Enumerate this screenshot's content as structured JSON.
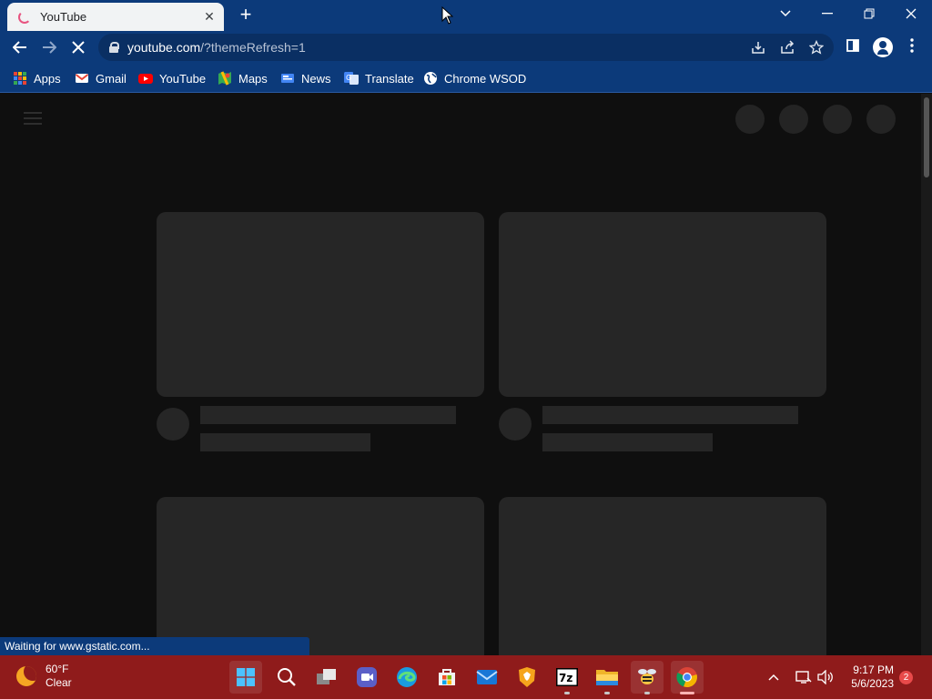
{
  "browser": {
    "tab": {
      "title": "YouTube",
      "close_icon": "close-icon"
    },
    "new_tab_icon": "plus-icon",
    "window_controls": [
      "tab-search-icon",
      "minimize-icon",
      "restore-icon",
      "close-icon"
    ],
    "url": {
      "host": "youtube.com",
      "path": "/?themeRefresh=1"
    },
    "bookmarks": [
      {
        "label": "Apps",
        "icon": "apps-grid-icon"
      },
      {
        "label": "Gmail",
        "icon": "gmail-icon"
      },
      {
        "label": "YouTube",
        "icon": "youtube-icon"
      },
      {
        "label": "Maps",
        "icon": "maps-icon"
      },
      {
        "label": "News",
        "icon": "news-icon"
      },
      {
        "label": "Translate",
        "icon": "translate-icon"
      },
      {
        "label": "Chrome WSOD",
        "icon": "globe-icon"
      }
    ],
    "status_text": "Waiting for www.gstatic.com..."
  },
  "taskbar": {
    "weather": {
      "temp": "60°F",
      "condition": "Clear"
    },
    "clock": {
      "time": "9:17 PM",
      "date": "5/6/2023"
    },
    "notification_count": "2",
    "apps": [
      "start-icon",
      "search-icon",
      "task-view-icon",
      "meet-icon",
      "edge-icon",
      "store-icon",
      "mail-icon",
      "brave-icon",
      "7zip-icon",
      "file-explorer-icon",
      "bee-app-icon",
      "chrome-icon"
    ]
  },
  "colors": {
    "browser_frame": "#0c3a7a",
    "page_bg": "#0f0f0f",
    "skeleton": "#262626",
    "taskbar": "#8f1b1b"
  }
}
